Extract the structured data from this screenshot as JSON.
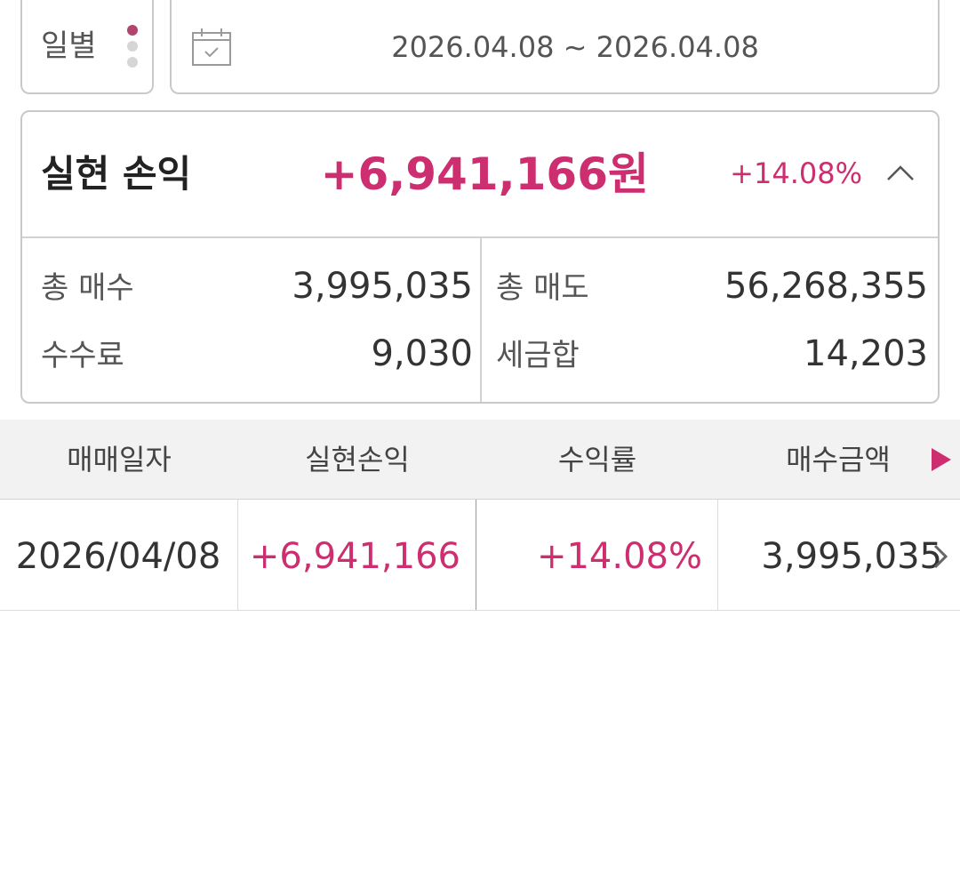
{
  "period": {
    "label": "일별"
  },
  "date_range": {
    "text": "2026.04.08 ~ 2026.04.08"
  },
  "summary": {
    "title": "실현 손익",
    "amount": "+6,941,166원",
    "rate": "+14.08%",
    "stats": {
      "total_buy_label": "총 매수",
      "total_buy_value": "3,995,035",
      "total_sell_label": "총 매도",
      "total_sell_value": "56,268,355",
      "fee_label": "수수료",
      "fee_value": "9,030",
      "tax_label": "세금합",
      "tax_value": "14,203"
    }
  },
  "table": {
    "headers": [
      "매매일자",
      "실현손익",
      "수익률",
      "매수금액"
    ],
    "rows": [
      {
        "date": "2026/04/08",
        "pnl": "+6,941,166",
        "rate": "+14.08%",
        "buy_amount": "3,995,035"
      }
    ]
  },
  "colors": {
    "accent": "#cc2e6f",
    "text_primary": "#333333",
    "border": "#c9c9c9",
    "header_bg": "#f2f2f2"
  },
  "icons": {
    "period_menu": "vertical-dots-icon",
    "calendar": "calendar-icon",
    "collapse": "chevron-up-icon",
    "scroll_columns": "play-right-icon",
    "row_detail": "chevron-right-icon"
  }
}
